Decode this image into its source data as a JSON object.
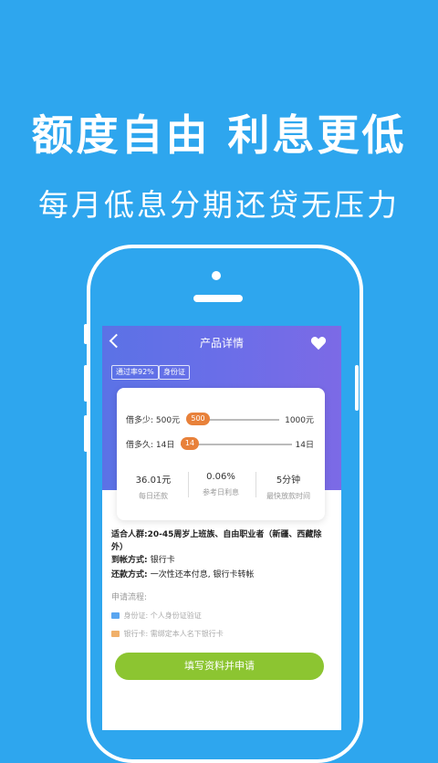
{
  "promo": {
    "headline": "额度自由 利息更低",
    "subline": "每月低息分期还贷无压力"
  },
  "screen": {
    "nav_title": "产品详情",
    "tags": [
      "通过率92%",
      "身份证"
    ],
    "loan_amount": {
      "label": "借多少: 500元",
      "value": "500",
      "max": "1000元",
      "fraction": 0.0
    },
    "loan_term": {
      "label": "借多久: 14日",
      "value": "14",
      "max": "14日",
      "fraction": 0.0
    },
    "stats": [
      {
        "value": "36.01元",
        "label": "每日还款"
      },
      {
        "value": "0.06%",
        "label": "参考日利息"
      },
      {
        "value": "5分钟",
        "label": "最快放款时间"
      }
    ],
    "info": {
      "audience_label": "适合人群:",
      "audience_value": "20-45周岁上班族、自由职业者（新疆、西藏除外）",
      "payout_label": "到帐方式:",
      "payout_value": "银行卡",
      "repay_label": "还款方式:",
      "repay_value": "一次性还本付息, 银行卡转帐"
    },
    "flow_title": "申请流程:",
    "flow": [
      {
        "name": "身份证:",
        "desc": "个人身份证验证",
        "color": "#5aa5f0"
      },
      {
        "name": "银行卡:",
        "desc": "需绑定本人名下银行卡",
        "color": "#f0b06a"
      }
    ],
    "apply_label": "填写资料并申请"
  },
  "colors": {
    "background": "#2ea6ee",
    "header_gradient_start": "#5b72e6",
    "accent_orange": "#e8813a",
    "button_green": "#8cc531"
  }
}
